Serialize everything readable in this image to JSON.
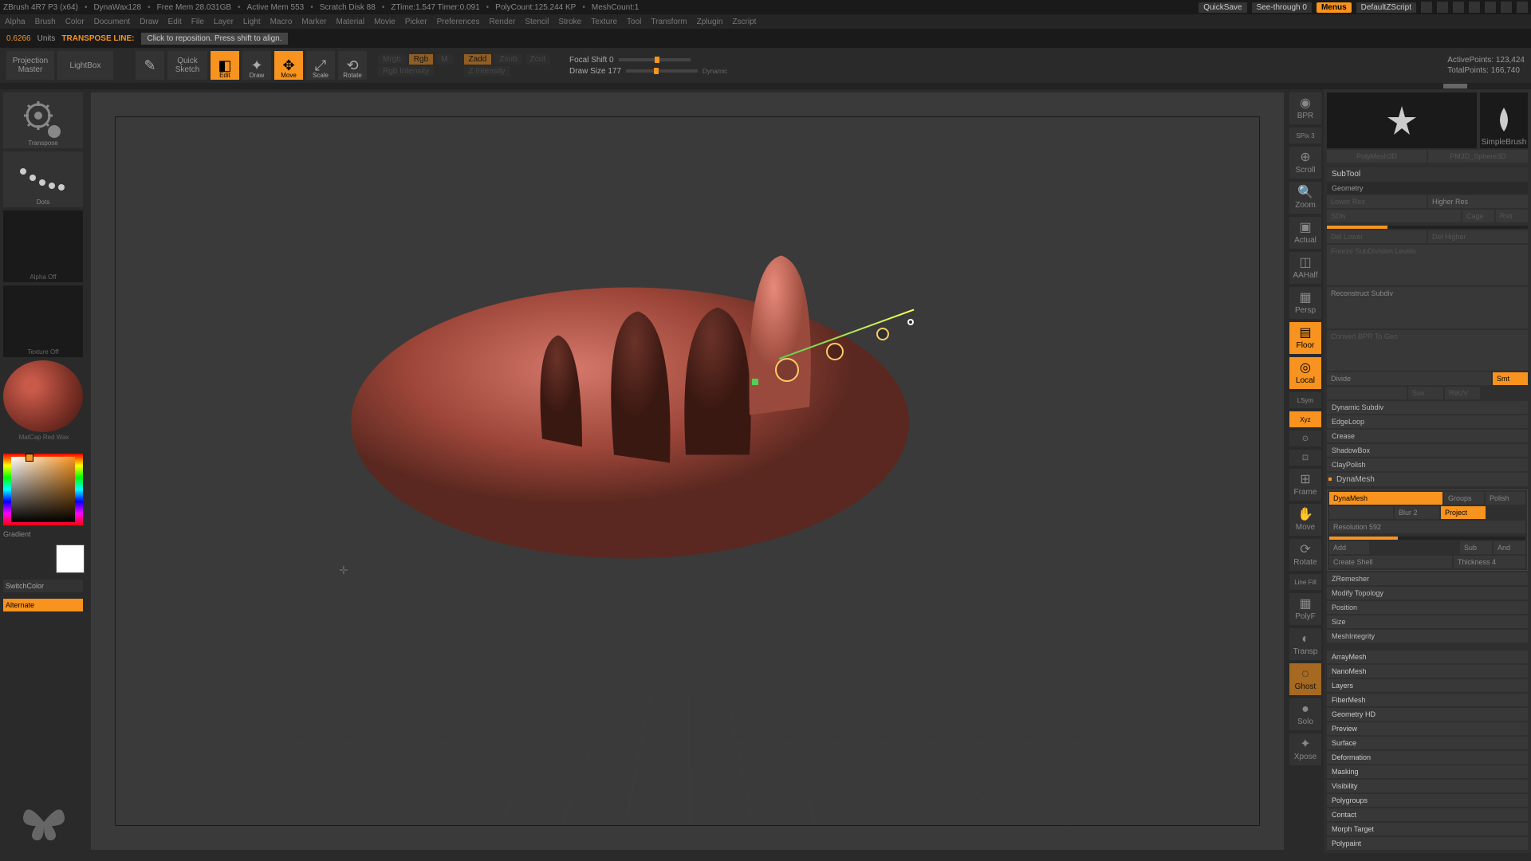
{
  "title": {
    "app": "ZBrush 4R7 P3 (x64)",
    "doc": "DynaWax128",
    "freemem": "Free Mem 28.031GB",
    "activemem": "Active Mem 553",
    "scratch": "Scratch Disk 88",
    "ztime": "ZTime:1.547 Timer:0.091",
    "polycount": "PolyCount:125.244 KP",
    "meshcount": "MeshCount:1",
    "quicksave": "QuickSave",
    "seethrough": "See-through   0",
    "menus": "Menus",
    "script": "DefaultZScript"
  },
  "menu": [
    "Alpha",
    "Brush",
    "Color",
    "Document",
    "Draw",
    "Edit",
    "File",
    "Layer",
    "Light",
    "Macro",
    "Marker",
    "Material",
    "Movie",
    "Picker",
    "Preferences",
    "Render",
    "Stencil",
    "Stroke",
    "Texture",
    "Tool",
    "Transform",
    "Zplugin",
    "Zscript"
  ],
  "status": {
    "val": "0.6266",
    "unit": "Units",
    "mode": "TRANSPOSE LINE:",
    "hint": "Click to reposition. Press shift to align."
  },
  "toolbar": {
    "projection": "Projection\nMaster",
    "lightbox": "LightBox",
    "quicksketch": "Quick\nSketch",
    "edit": "Edit",
    "draw": "Draw",
    "move": "Move",
    "scale": "Scale",
    "rotate": "Rotate",
    "mrgb": "Mrgb",
    "rgb": "Rgb",
    "m": "M",
    "rgbint": "Rgb Intensity",
    "zadd": "Zadd",
    "zsub": "Zsub",
    "zcut": "Zcut",
    "zint": "Z Intensity",
    "focal": "Focal Shift 0",
    "drawsize": "Draw Size 177",
    "dynamic": "Dynamic",
    "active": "ActivePoints: 123,424",
    "total": "TotalPoints: 166,740"
  },
  "left": {
    "transpose": "Transpose",
    "dots": "Dots",
    "alpha": "Alpha Off",
    "texture": "Texture Off",
    "matcap": "MatCap Red Wax",
    "gradient": "Gradient",
    "switchcolor": "SwitchColor",
    "alternate": "Alternate"
  },
  "rtools": {
    "bpr": "BPR",
    "spix": "SPix 3",
    "scroll": "Scroll",
    "zoom": "Zoom",
    "actual": "Actual",
    "aahalf": "AAHalf",
    "persp": "Persp",
    "floor": "Floor",
    "local": "Local",
    "lsym": "LSym",
    "xyz": "Xyz",
    "frame": "Frame",
    "move": "Move",
    "rotate": "Rotate",
    "linefill": "Line Fill",
    "polyf": "PolyF",
    "transp": "Transp",
    "ghost": "Ghost",
    "solo": "Solo",
    "xpose": "Xpose"
  },
  "rp": {
    "brush1": "SimpleBrush",
    "tool1": "PolyMesh3D",
    "tool2": "PM3D_Sphere3D",
    "subtool": "SubTool",
    "geometry": "Geometry",
    "lowres": "Lower Res",
    "highres": "Higher Res",
    "sdiv": "SDiv",
    "cage": "Cage",
    "rstr": "Rstr",
    "dellower": "Del Lower",
    "delhigher": "Del Higher",
    "freeze": "Freeze SubDivision Levels",
    "reconstruct": "Reconstruct Subdiv",
    "convert": "Convert BPR To Geo",
    "divide": "Divide",
    "smt": "Smt",
    "suv": "Suv",
    "rsuv": "ReUV",
    "dynsubdiv": "Dynamic Subdiv",
    "edgeloop": "EdgeLoop",
    "crease": "Crease",
    "shadowbox": "ShadowBox",
    "claypolish": "ClayPolish",
    "dynamesh_h": "DynaMesh",
    "dynamesh": "DynaMesh",
    "groups": "Groups",
    "polish": "Polish",
    "blur": "Blur 2",
    "project": "Project",
    "resolution": "Resolution 592",
    "add": "Add",
    "sub": "Sub",
    "and": "And",
    "createshell": "Create Shell",
    "thickness": "Thickness 4",
    "zremesher": "ZRemesher",
    "modtopo": "Modify Topology",
    "position": "Position",
    "size": "Size",
    "meshint": "MeshIntegrity",
    "arraymesh": "ArrayMesh",
    "nanomesh": "NanoMesh",
    "layers": "Layers",
    "fibermesh": "FiberMesh",
    "geomhd": "Geometry HD",
    "preview": "Preview",
    "surface": "Surface",
    "deformation": "Deformation",
    "masking": "Masking",
    "visibility": "Visibility",
    "polygroups": "Polygroups",
    "contact": "Contact",
    "morph": "Morph Target",
    "polypaint": "Polypaint"
  }
}
